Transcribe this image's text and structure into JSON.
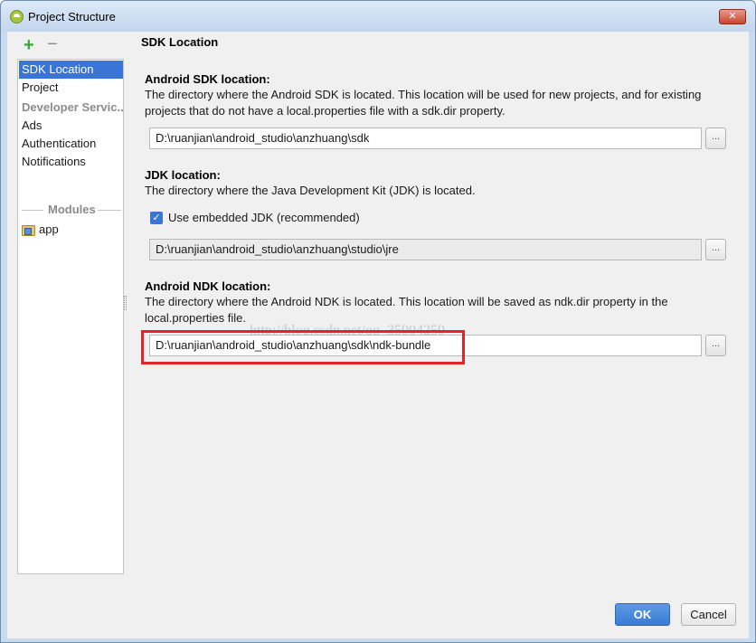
{
  "window": {
    "title": "Project Structure",
    "close_label": "✕"
  },
  "toolbar": {
    "add_label": "+",
    "remove_label": "−"
  },
  "sidebar": {
    "items": [
      {
        "label": "SDK Location",
        "selected": true
      },
      {
        "label": "Project",
        "selected": false
      }
    ],
    "developer_header": "Developer Servic...",
    "developer_items": [
      "Ads",
      "Authentication",
      "Notifications"
    ],
    "modules_header": "Modules",
    "modules": [
      "app"
    ]
  },
  "panel": {
    "title": "SDK Location",
    "sdk": {
      "title": "Android SDK location:",
      "description": "The directory where the Android SDK is located. This location will be used for new projects, and for existing projects that do not have a local.properties file with a sdk.dir property.",
      "value": "D:\\ruanjian\\android_studio\\anzhuang\\sdk",
      "browse_label": "..."
    },
    "jdk": {
      "title": "JDK location:",
      "description": "The directory where the Java Development Kit (JDK) is located.",
      "checkbox_label": "Use embedded JDK (recommended)",
      "checkbox_checked": true,
      "value": "D:\\ruanjian\\android_studio\\anzhuang\\studio\\jre",
      "browse_label": "..."
    },
    "ndk": {
      "title": "Android NDK location:",
      "description": "The directory where the Android NDK is located. This location will be saved as ndk.dir property in the local.properties file.",
      "value": "D:\\ruanjian\\android_studio\\anzhuang\\sdk\\ndk-bundle",
      "browse_label": "..."
    },
    "watermark": "http://blog.csdn.net/qq_35904259"
  },
  "footer": {
    "ok_label": "OK",
    "cancel_label": "Cancel"
  },
  "colors": {
    "accent": "#3875d7",
    "highlight": "#e2232a"
  }
}
